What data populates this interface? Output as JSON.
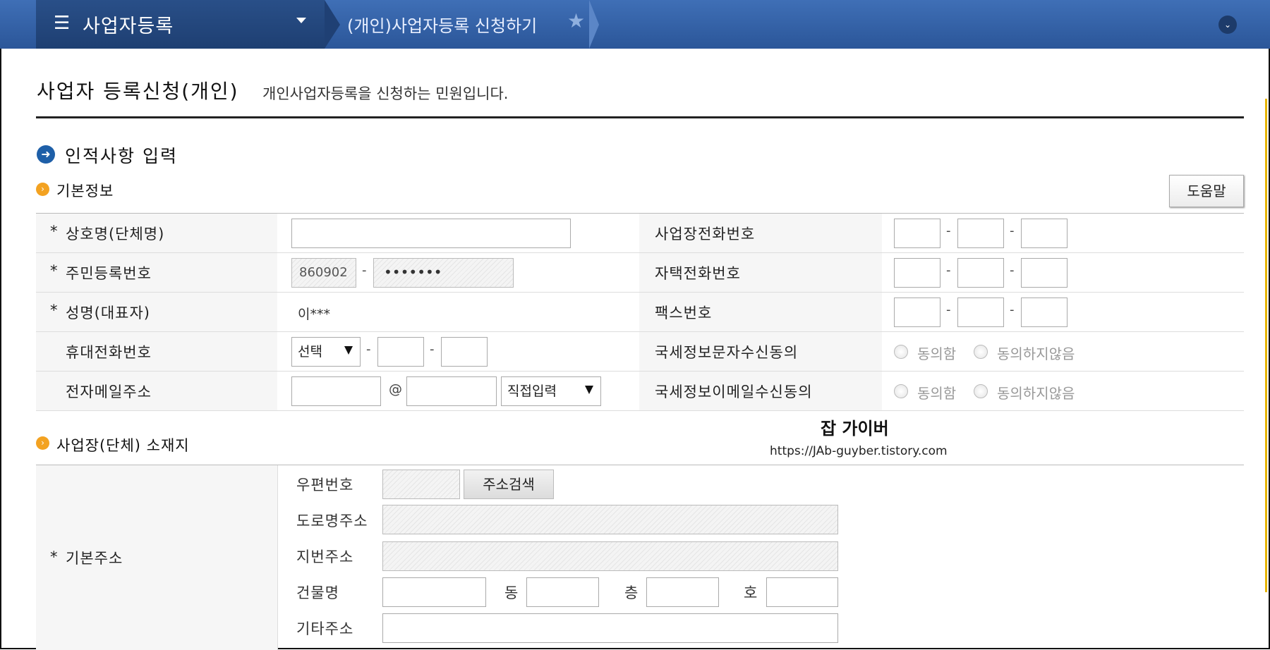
{
  "nav": {
    "menu_title": "사업자등록",
    "breadcrumb": "(개인)사업자등록 신청하기",
    "menu_icon": "hamburger-icon",
    "star_icon": "star-icon",
    "expand_icon": "chevron-down-icon"
  },
  "header": {
    "title": "사업자 등록신청(개인)",
    "description": "개인사업자등록을 신청하는 민원입니다."
  },
  "section": {
    "title": "인적사항 입력",
    "basic_info_title": "기본정보",
    "help_button": "도움말",
    "location_title": "사업장(단체) 소재지"
  },
  "form": {
    "left_labels": {
      "company_name": "상호명(단체명)",
      "resident_number": "주민등록번호",
      "name": "성명(대표자)",
      "mobile": "휴대전화번호",
      "email": "전자메일주소"
    },
    "right_labels": {
      "business_phone": "사업장전화번호",
      "home_phone": "자택전화번호",
      "fax": "팩스번호",
      "sms_consent": "국세정보문자수신동의",
      "email_consent": "국세정보이메일수신동의"
    },
    "required_mark": "*",
    "dash": "-",
    "at_sign": "@",
    "resident_front": "860902",
    "resident_back": "•••••••",
    "name_value": "이***",
    "mobile_select": "선택",
    "email_domain_select": "직접입력",
    "agree": "동의함",
    "disagree": "동의하지않음"
  },
  "watermark": {
    "title": "잡 가이버",
    "url": "https://JAb-guyber.tistory.com"
  },
  "address": {
    "label": "기본주소",
    "zip_label": "우편번호",
    "search_button": "주소검색",
    "road_label": "도로명주소",
    "lot_label": "지번주소",
    "building_label": "건물명",
    "dong": "동",
    "floor": "층",
    "ho": "호",
    "etc_label": "기타주소"
  },
  "colors": {
    "nav_bg": "#2f5fa6",
    "required": "#c0162a",
    "section_icon": "#1e5fa8",
    "sub_icon": "#f3a221"
  }
}
